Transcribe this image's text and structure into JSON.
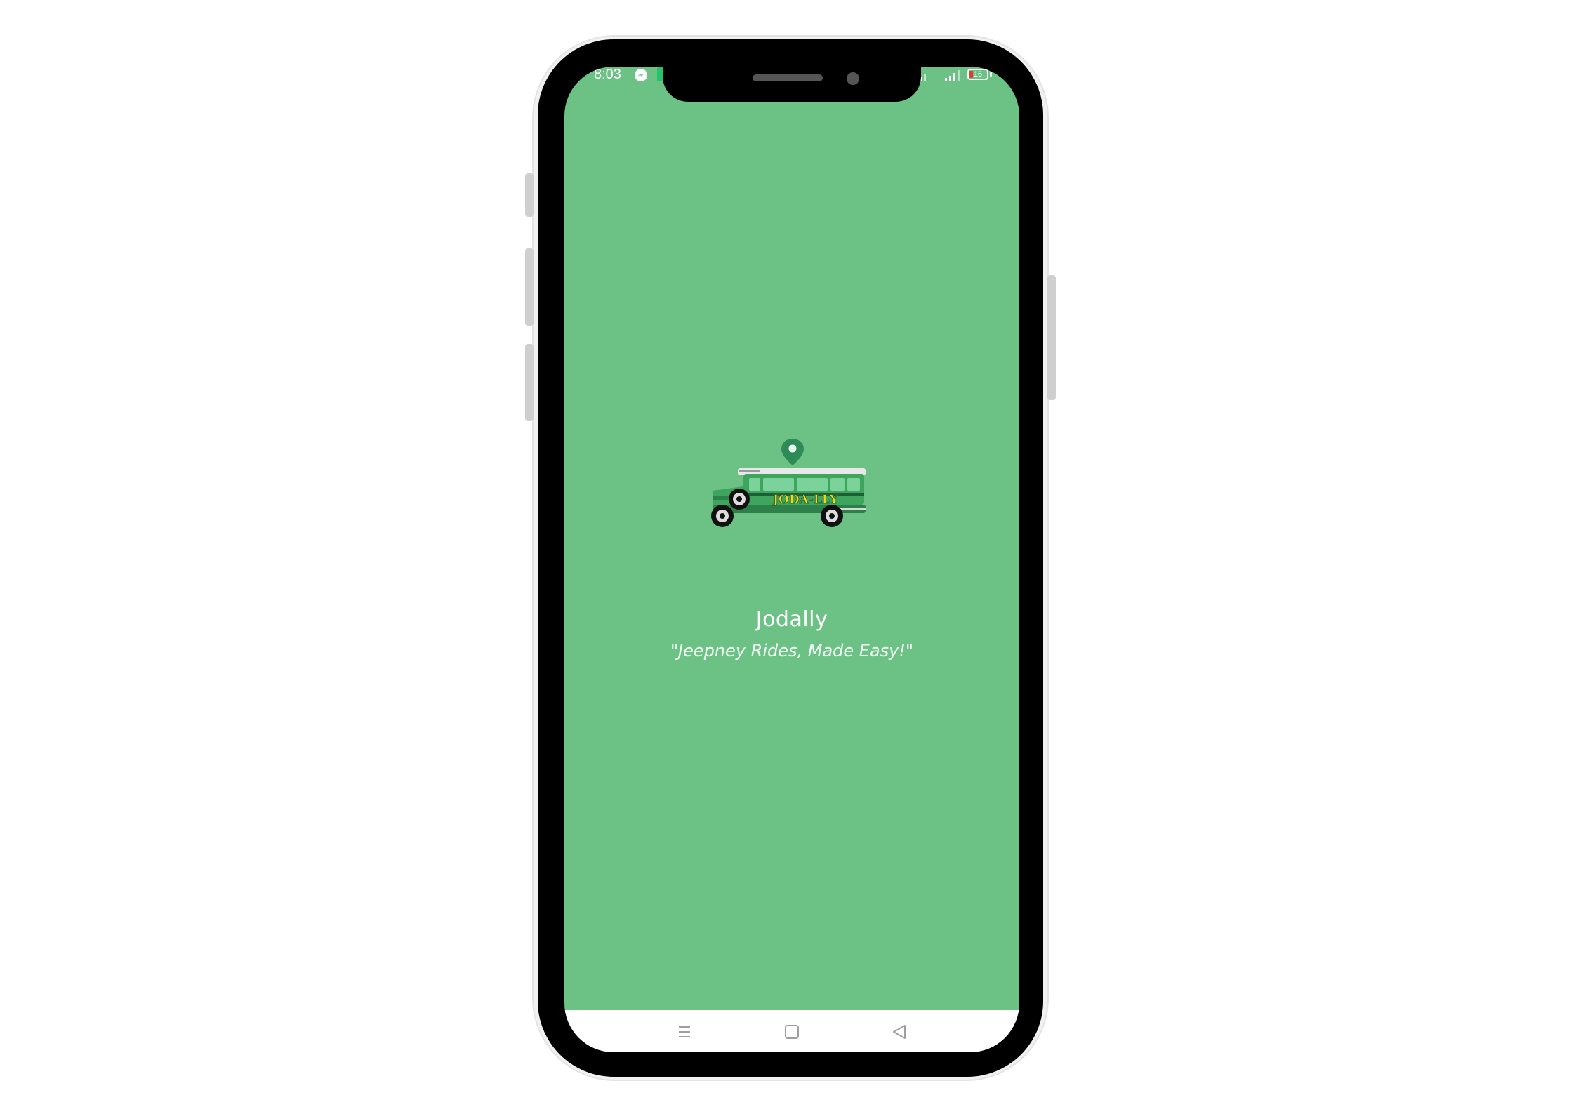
{
  "status_bar": {
    "time": "8:03",
    "battery_level": "16",
    "icons": [
      "messenger-icon",
      "signal-icon",
      "battery-icon"
    ]
  },
  "splash": {
    "logo_text": "JODA-LLY",
    "app_name": "Jodally",
    "tagline": "\"Jeepney Rides, Made Easy!\""
  },
  "nav_bar": {
    "buttons": [
      "menu-icon",
      "home-icon",
      "back-icon"
    ]
  },
  "colors": {
    "background": "#6cc285",
    "accent_green": "#2e8b57",
    "logo_yellow": "#ffd600"
  }
}
